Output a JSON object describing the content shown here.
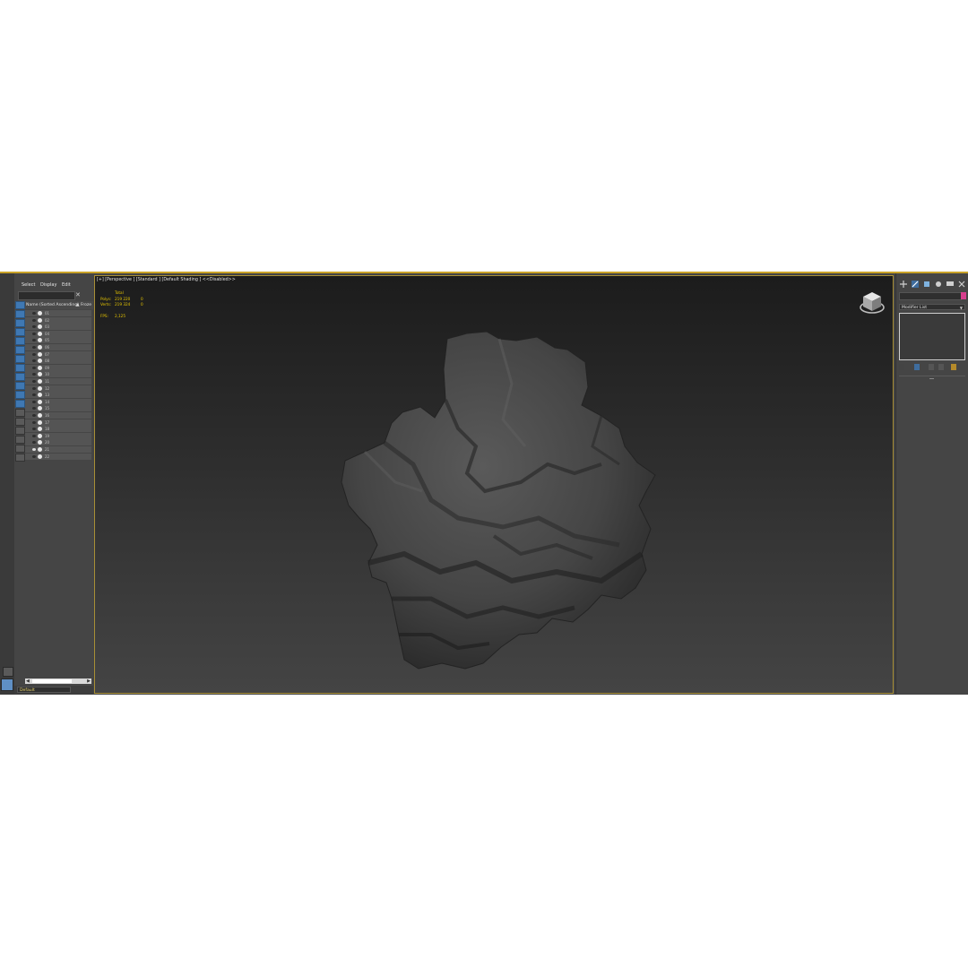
{
  "explorer": {
    "menu": [
      "Select",
      "Display",
      "Edit"
    ],
    "column_header": "Name (Sorted Ascending)",
    "column_header2": "▲ Froze",
    "clear_icon": "✕",
    "rows": [
      "01",
      "02",
      "03",
      "04",
      "05",
      "06",
      "07",
      "08",
      "09",
      "10",
      "11",
      "12",
      "13",
      "14",
      "15",
      "16",
      "17",
      "18",
      "19",
      "20",
      "21",
      "22"
    ],
    "visible_row_index": 20,
    "layer_name": "Default"
  },
  "viewport": {
    "label": "[+] [Perspective ] [Standard ] [Default Shading ]  <<Disabled>>",
    "stats": {
      "header": "Total",
      "polys_label": "Polys:",
      "polys_value": "219 220",
      "polys_sel": "0",
      "verts_label": "Verts:",
      "verts_value": "219 324",
      "verts_sel": "0",
      "fps_label": "FPS:",
      "fps_value": "2,125"
    }
  },
  "command_panel": {
    "modifier_list": "Modifier List",
    "object_color": "#d63e8d"
  },
  "colors": {
    "accent": "#c9a227",
    "stats_text": "#e5c400",
    "tool_blue": "#3f78b3"
  }
}
